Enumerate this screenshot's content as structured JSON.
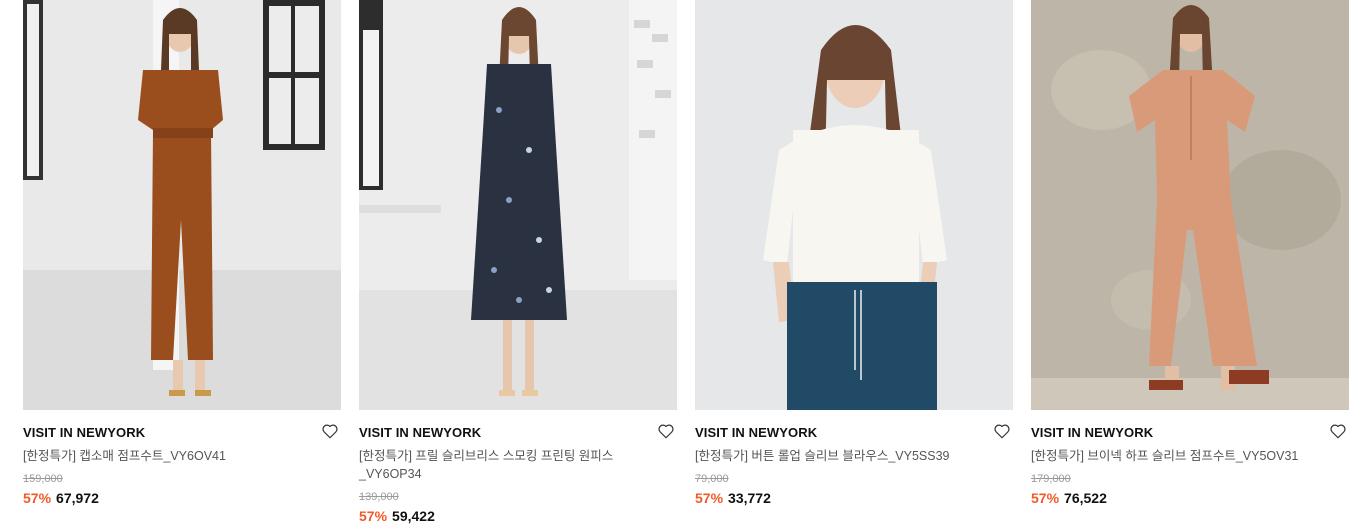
{
  "products": [
    {
      "brand": "VISIT IN NEWYORK",
      "name": "[한정특가] 캡소매 점프수트_VY6OV41",
      "original_price": "159,000",
      "discount": "57%",
      "price": "67,972",
      "image": "model-rust-jumpsuit",
      "wish_icon": "heart-outline-icon"
    },
    {
      "brand": "VISIT IN NEWYORK",
      "name": "[한정특가] 프릴 슬리브리스 스모킹 프린팅 원피스_VY6OP34",
      "original_price": "139,000",
      "discount": "57%",
      "price": "59,422",
      "image": "model-floral-dress",
      "wish_icon": "heart-outline-icon"
    },
    {
      "brand": "VISIT IN NEWYORK",
      "name": "[한정특가] 버튼 롤업 슬리브 블라우스_VY5SS39",
      "original_price": "79,000",
      "discount": "57%",
      "price": "33,772",
      "image": "model-white-blouse",
      "wish_icon": "heart-outline-icon"
    },
    {
      "brand": "VISIT IN NEWYORK",
      "name": "[한정특가] 브이넥 하프 슬리브 점프수트_VY5OV31",
      "original_price": "179,000",
      "discount": "57%",
      "price": "76,522",
      "image": "model-peach-jumpsuit",
      "wish_icon": "heart-outline-icon"
    }
  ],
  "colors": {
    "discount": "#f2592a",
    "brand_text": "#111111",
    "name_text": "#555555",
    "strike_text": "#9a9a9a"
  }
}
